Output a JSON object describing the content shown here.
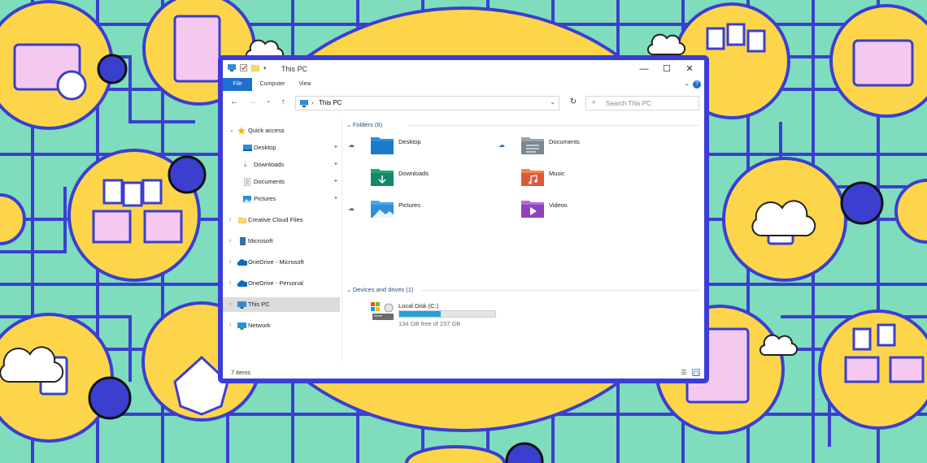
{
  "window": {
    "title": "This PC",
    "controls": {
      "minimize": "—",
      "maximize": "☐",
      "close": "✕"
    },
    "ribbon_tabs": [
      "File",
      "Computer",
      "View"
    ],
    "help_label": "?"
  },
  "addressbar": {
    "path": "This PC",
    "search_placeholder": "Search This PC"
  },
  "sidebar": {
    "items": [
      {
        "label": "Quick access",
        "icon": "star-icon"
      },
      {
        "label": "Desktop",
        "icon": "desktop-folder-icon",
        "pinned": true
      },
      {
        "label": "Downloads",
        "icon": "download-arrow-icon",
        "pinned": true
      },
      {
        "label": "Documents",
        "icon": "documents-icon",
        "pinned": true
      },
      {
        "label": "Pictures",
        "icon": "pictures-icon",
        "pinned": true
      },
      {
        "label": "Creative Cloud Files",
        "icon": "creative-cloud-icon"
      },
      {
        "label": "Microsoft",
        "icon": "document-icon"
      },
      {
        "label": "OneDrive - Microsoft",
        "icon": "onedrive-cloud-icon"
      },
      {
        "label": "OneDrive - Personal",
        "icon": "onedrive-cloud-icon"
      },
      {
        "label": "This PC",
        "icon": "monitor-icon",
        "selected": true
      },
      {
        "label": "Network",
        "icon": "network-icon"
      }
    ]
  },
  "main": {
    "folders_header": "Folders (6)",
    "folders": [
      {
        "label": "Desktop",
        "icon": "desktop-folder-icon",
        "cloud": true
      },
      {
        "label": "Documents",
        "icon": "documents-folder-icon",
        "cloud": true
      },
      {
        "label": "Downloads",
        "icon": "downloads-folder-icon",
        "cloud": false
      },
      {
        "label": "Music",
        "icon": "music-folder-icon",
        "cloud": false
      },
      {
        "label": "Pictures",
        "icon": "pictures-folder-icon",
        "cloud": true
      },
      {
        "label": "Videos",
        "icon": "videos-folder-icon",
        "cloud": false
      }
    ],
    "devices_header": "Devices and drives (1)",
    "drive": {
      "label": "Local Disk (C:)",
      "free_text": "134 GB free of 237 GB",
      "used_fraction": 0.435
    }
  },
  "status": {
    "item_count": "7 items"
  },
  "colors": {
    "accent": "#1e6fd0",
    "window_border": "#3b3dd6",
    "background": "#7fdcbc",
    "circle": "#fdd54a"
  }
}
